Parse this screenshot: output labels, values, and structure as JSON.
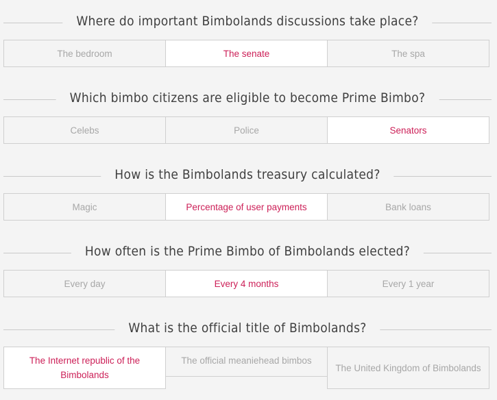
{
  "questions": [
    {
      "text": "Where do important Bimbolands discussions take place?",
      "options": [
        "The bedroom",
        "The senate",
        "The spa"
      ],
      "selected": 1
    },
    {
      "text": "Which bimbo citizens are eligible to become Prime Bimbo?",
      "options": [
        "Celebs",
        "Police",
        "Senators"
      ],
      "selected": 2
    },
    {
      "text": "How is the Bimbolands treasury calculated?",
      "options": [
        "Magic",
        "Percentage of user payments",
        "Bank loans"
      ],
      "selected": 1
    },
    {
      "text": "How often is the Prime Bimbo of Bimbolands elected?",
      "options": [
        "Every day",
        "Every 4 months",
        "Every 1 year"
      ],
      "selected": 1
    },
    {
      "text": "What is the official title of Bimbolands?",
      "options": [
        "The Internet republic of the Bimbolands",
        "The official meaniehead bimbos",
        "The United Kingdom of Bimbolands"
      ],
      "selected": 0
    }
  ],
  "colors": {
    "background": "#f4f4f4",
    "selected_text": "#cc1f57",
    "unselected_text": "#a7a7a7",
    "question_text": "#3f3f3f",
    "border": "#cfcfcf"
  }
}
